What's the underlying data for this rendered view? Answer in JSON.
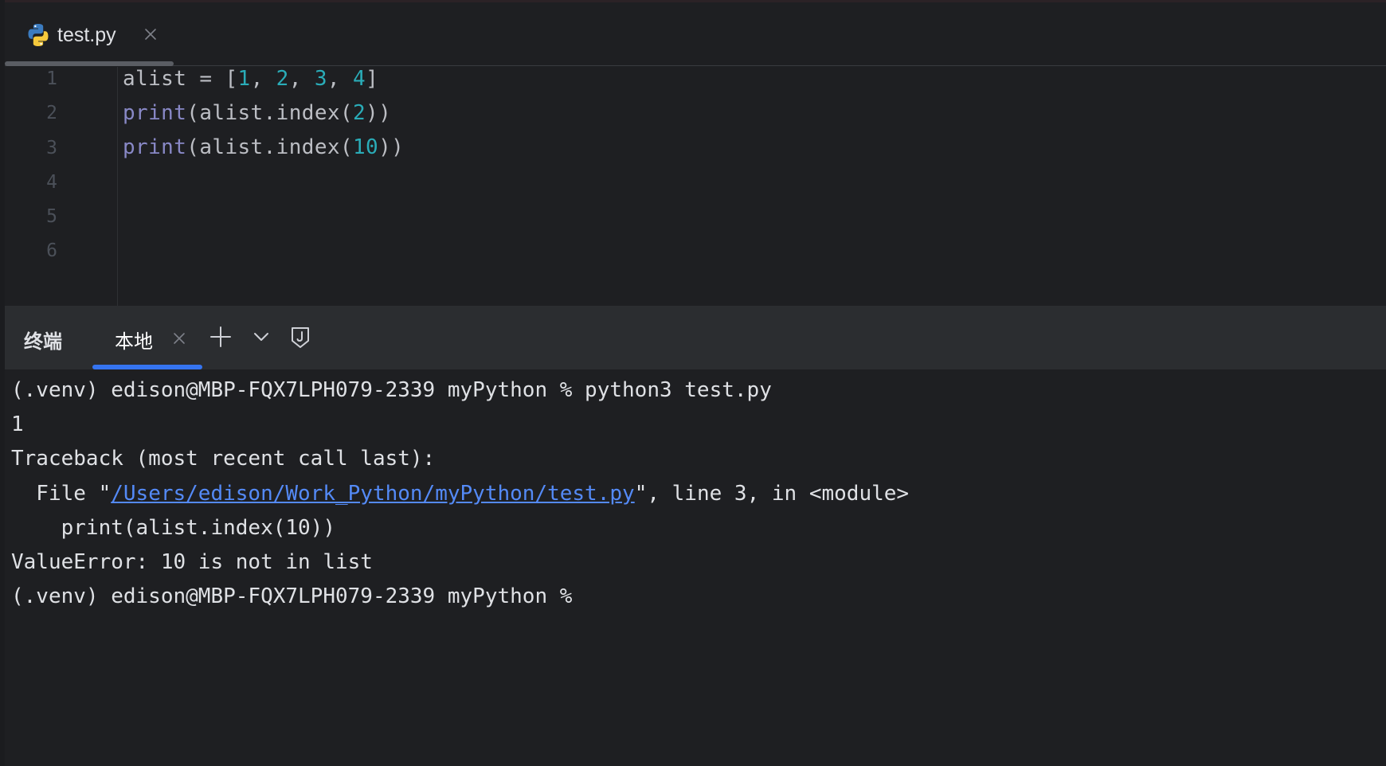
{
  "editor": {
    "tab": {
      "filename": "test.py"
    },
    "line_numbers": [
      "1",
      "2",
      "3",
      "4",
      "5",
      "6"
    ],
    "code": {
      "line1": {
        "var": "alist",
        "assign": " = [",
        "n1": "1",
        "sep1": ", ",
        "n2": "2",
        "sep2": ", ",
        "n3": "3",
        "sep3": ", ",
        "n4": "4",
        "end": "]"
      },
      "line2": {
        "fn": "print",
        "mid": "(alist.index(",
        "arg": "2",
        "end": "))"
      },
      "line3": {
        "fn": "print",
        "mid": "(alist.index(",
        "arg": "10",
        "end": "))"
      }
    }
  },
  "terminal": {
    "title": "终端",
    "tab_label": "本地",
    "lines": {
      "cmd": "(.venv) edison@MBP-FQX7LPH079-2339 myPython % python3 test.py",
      "out1": "1",
      "traceback": "Traceback (most recent call last):",
      "file_prefix": "  File \"",
      "file_link": "/Users/edison/Work_Python/myPython/test.py",
      "file_suffix": "\", line 3, in <module>",
      "code_echo": "    print(alist.index(10))",
      "error": "ValueError: 10 is not in list",
      "prompt": "(.venv) edison@MBP-FQX7LPH079-2339 myPython % "
    }
  },
  "colors": {
    "background": "#1e1f22",
    "function": "#8888c6",
    "number": "#2aacb8",
    "link": "#548af7",
    "active_tab_underline": "#3574f0"
  }
}
